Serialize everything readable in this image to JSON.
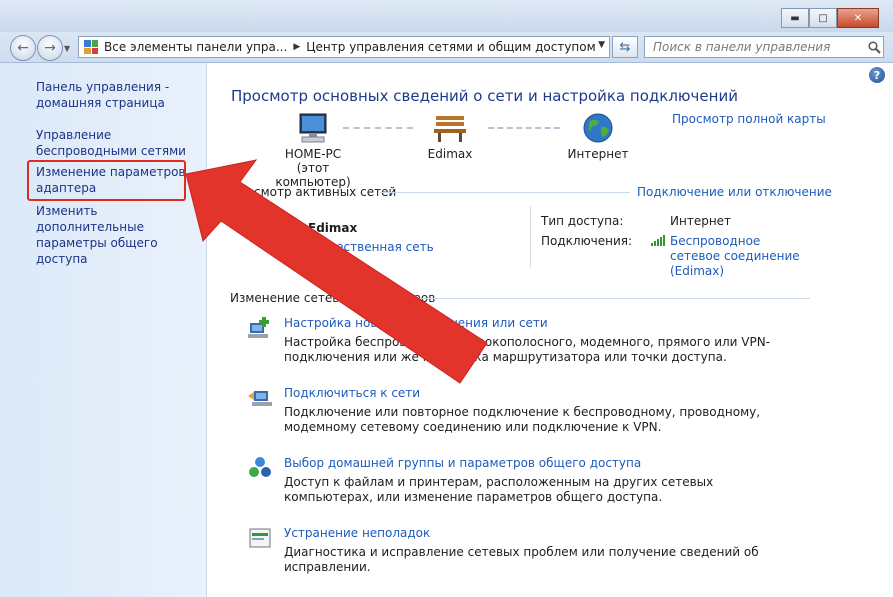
{
  "window": {
    "min_glyph": "▬",
    "max_glyph": "□",
    "close_glyph": "✕"
  },
  "address_bar": {
    "back_glyph": "←",
    "forward_glyph": "→",
    "crumbs": [
      "Все элементы панели упра...",
      "Центр управления сетями и общим доступом"
    ],
    "search_placeholder": "Поиск в панели управления"
  },
  "sidebar": {
    "items": [
      {
        "label": "Панель управления - домашняя страница"
      },
      {
        "label": "Управление беспроводными сетями"
      },
      {
        "label": "Изменение параметров адаптера",
        "highlighted": true
      },
      {
        "label": "Изменить дополнительные параметры общего доступа"
      }
    ],
    "highlight_color": "#e02a24"
  },
  "main": {
    "help_glyph": "?",
    "title": "Просмотр основных сведений о сети и настройка подключений",
    "full_map_link": "Просмотр полной карты",
    "map": {
      "computer_name": "HOME-PC",
      "computer_sub": "(этот компьютер)",
      "network_name": "Edimax",
      "internet_label": "Интернет"
    },
    "active": {
      "header": "Просмотр активных сетей",
      "connect_link": "Подключение или отключение",
      "network_name": "Edimax",
      "network_type": "Общественная сеть",
      "access_label": "Тип доступа:",
      "access_value": "Интернет",
      "connections_label": "Подключения:",
      "connections_value": "Беспроводное сетевое соединение (Edimax)"
    },
    "change": {
      "header": "Изменение сетевых параметров",
      "tasks": [
        {
          "icon": "new-connection-icon",
          "link": "Настройка нового подключения или сети",
          "desc": "Настройка беспроводного, широкополосного, модемного, прямого или VPN-подключения или же настройка маршрутизатора или точки доступа."
        },
        {
          "icon": "connect-to-network-icon",
          "link": "Подключиться к сети",
          "desc": "Подключение или повторное подключение к беспроводному, проводному, модемному сетевому соединению или подключение к VPN."
        },
        {
          "icon": "homegroup-icon",
          "link": "Выбор домашней группы и параметров общего доступа",
          "desc": "Доступ к файлам и принтерам, расположенным на других сетевых компьютерах, или изменение параметров общего доступа."
        },
        {
          "icon": "troubleshoot-icon",
          "link": "Устранение неполадок",
          "desc": "Диагностика и исправление сетевых проблем или получение сведений об исправлении."
        }
      ]
    }
  },
  "colors": {
    "link": "#1e5bbd",
    "title": "#1e3b8a",
    "arrow": "#e3342c"
  }
}
